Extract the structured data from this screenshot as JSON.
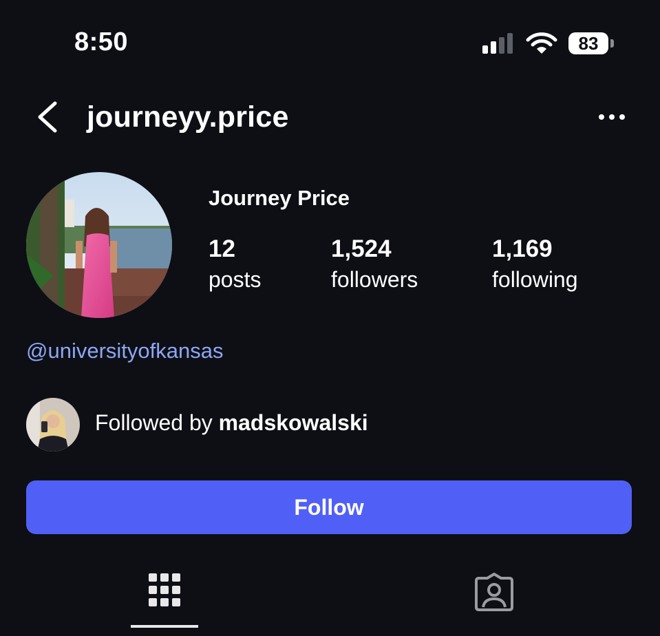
{
  "status_bar": {
    "time": "8:50",
    "battery": "83",
    "signal_icon": "cellular-signal-icon",
    "wifi_icon": "wifi-icon"
  },
  "header": {
    "username": "journeyy.price",
    "back_icon": "chevron-left-icon",
    "more_icon": "more-options-icon"
  },
  "profile": {
    "full_name": "Journey Price",
    "stats": {
      "posts": {
        "count": "12",
        "label": "posts"
      },
      "followers": {
        "count": "1,524",
        "label": "followers"
      },
      "following": {
        "count": "1,169",
        "label": "following"
      }
    },
    "bio_link": "@universityofkansas"
  },
  "mutual": {
    "prefix": "Followed by",
    "name": "madskowalski"
  },
  "actions": {
    "follow_label": "Follow"
  },
  "tabs": {
    "grid_icon": "grid-icon",
    "tagged_icon": "tagged-person-icon",
    "active": "grid"
  },
  "colors": {
    "background": "#0d0f15",
    "follow_button": "#5060f6",
    "link": "#8ea6f4"
  }
}
